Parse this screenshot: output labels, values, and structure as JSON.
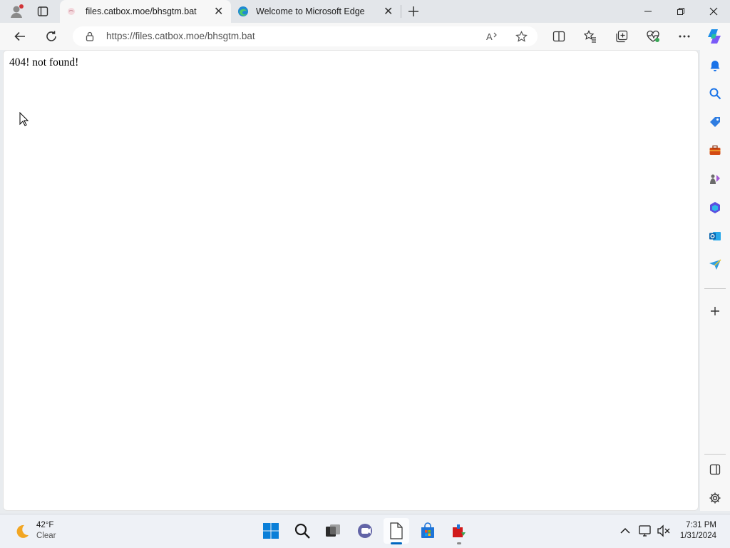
{
  "browser": {
    "tabs": [
      {
        "title": "files.catbox.moe/bhsgtm.bat",
        "active": true
      },
      {
        "title": "Welcome to Microsoft Edge",
        "active": false
      }
    ],
    "address": "https://files.catbox.moe/bhsgtm.bat",
    "icons": {
      "profile": "profile-icon",
      "workspaces": "tab-actions-icon",
      "back": "back-arrow-icon",
      "refresh": "refresh-icon",
      "lock": "lock-icon",
      "read_aloud": "read-aloud-icon",
      "favorite": "star-icon",
      "split": "split-screen-icon",
      "favorites": "favorites-icon",
      "collections": "collections-icon",
      "performance": "heart-pulse-icon",
      "more": "more-icon",
      "copilot": "copilot-icon"
    }
  },
  "page": {
    "text": "404! not found!"
  },
  "sidebar": {
    "items": [
      "bell-icon",
      "search-icon",
      "shopping-tag-icon",
      "toolbox-icon",
      "games-icon",
      "microsoft365-icon",
      "outlook-icon",
      "send-icon"
    ],
    "add": "plus-icon",
    "bottom": [
      "sidebar-toggle-icon",
      "settings-icon"
    ]
  },
  "taskbar": {
    "weather": {
      "temp": "42°F",
      "condition": "Clear"
    },
    "apps": [
      "start-icon",
      "search-icon",
      "task-view-icon",
      "teams-icon",
      "file-icon",
      "store-icon",
      "app-icon"
    ],
    "clock": {
      "time": "7:31 PM",
      "date": "1/31/2024"
    }
  },
  "colors": {
    "accent": "#0067c0",
    "chrome": "#f7f7f7",
    "tabbar": "#e3e6ea"
  }
}
